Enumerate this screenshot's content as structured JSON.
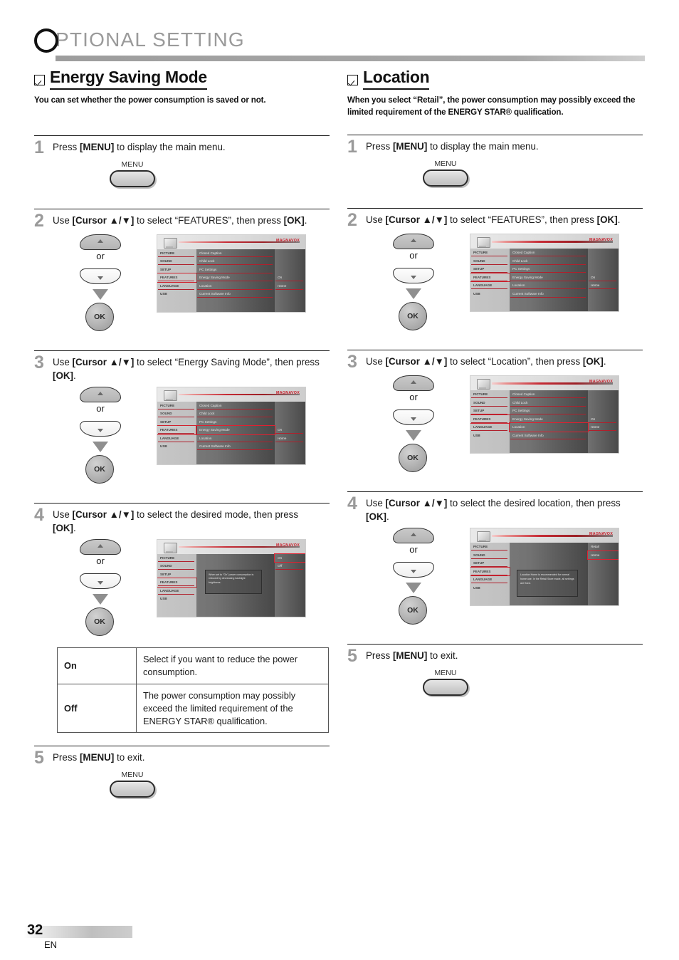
{
  "header": {
    "initial": "O",
    "title": "PTIONAL  SETTING"
  },
  "footer": {
    "page_number": "32",
    "language": "EN"
  },
  "osd_common": {
    "logo": "MAGNAVOX",
    "left_menu": [
      "PICTURE",
      "SOUND",
      "SETUP",
      "FEATURES",
      "LANGUAGE",
      "USB"
    ],
    "features_items": [
      "Closed Caption",
      "Child Lock",
      "PC Settings",
      "Energy Saving Mode",
      "Location",
      "Current Software Info"
    ],
    "values": {
      "energy_saving": "On",
      "location": "Home"
    },
    "energy_tip": "When set to \"On\" power consumption is reduced by decreasing backlight brightness.",
    "location_tip": "Location Home is recommended for normal home use. In the Retail Store mode, all settings are fixed.",
    "energy_options": [
      "On",
      "Off"
    ],
    "location_options": [
      "Retail",
      "Home"
    ]
  },
  "controls": {
    "menu_label": "MENU",
    "ok_label": "OK",
    "or_label": "or"
  },
  "left": {
    "title": "Energy Saving Mode",
    "description": "You can set whether the power consumption is saved or not.",
    "steps": [
      {
        "num": "1",
        "text_pre": "Press ",
        "text_b1": "[MENU]",
        "text_post": " to display the main menu."
      },
      {
        "num": "2",
        "text_pre": "Use ",
        "text_b1": "[Cursor ▲/▼]",
        "text_post": " to select “FEATURES”, then press ",
        "text_b2": "[OK]",
        "text_end": "."
      },
      {
        "num": "3",
        "text_pre": "Use ",
        "text_b1": "[Cursor ▲/▼]",
        "text_post": " to select “Energy Saving Mode”, then press ",
        "text_b2": "[OK]",
        "text_end": "."
      },
      {
        "num": "4",
        "text_pre": "Use ",
        "text_b1": "[Cursor ▲/▼]",
        "text_post": " to select the desired mode, then press ",
        "text_b2": "[OK]",
        "text_end": "."
      },
      {
        "num": "5",
        "text_pre": "Press ",
        "text_b1": "[MENU]",
        "text_post": " to exit."
      }
    ],
    "table": {
      "rows": [
        {
          "key": "On",
          "value": "Select if you want to reduce the power consumption."
        },
        {
          "key": "Off",
          "value": "The power consumption may possibly exceed the limited requirement of the ENERGY STAR® qualification."
        }
      ]
    }
  },
  "right": {
    "title": "Location",
    "description": "When you select “Retail”, the power consumption may possibly exceed the limited requirement of the ENERGY STAR® qualification.",
    "steps": [
      {
        "num": "1",
        "text_pre": "Press ",
        "text_b1": "[MENU]",
        "text_post": " to display the main menu."
      },
      {
        "num": "2",
        "text_pre": "Use ",
        "text_b1": "[Cursor ▲/▼]",
        "text_post": " to select “FEATURES”, then press ",
        "text_b2": "[OK]",
        "text_end": "."
      },
      {
        "num": "3",
        "text_pre": "Use ",
        "text_b1": "[Cursor ▲/▼]",
        "text_post": " to select “Location”, then press ",
        "text_b2": "[OK]",
        "text_end": "."
      },
      {
        "num": "4",
        "text_pre": "Use ",
        "text_b1": "[Cursor ▲/▼]",
        "text_post": " to select the desired location, then press ",
        "text_b2": "[OK]",
        "text_end": "."
      },
      {
        "num": "5",
        "text_pre": "Press ",
        "text_b1": "[MENU]",
        "text_post": " to exit."
      }
    ]
  }
}
